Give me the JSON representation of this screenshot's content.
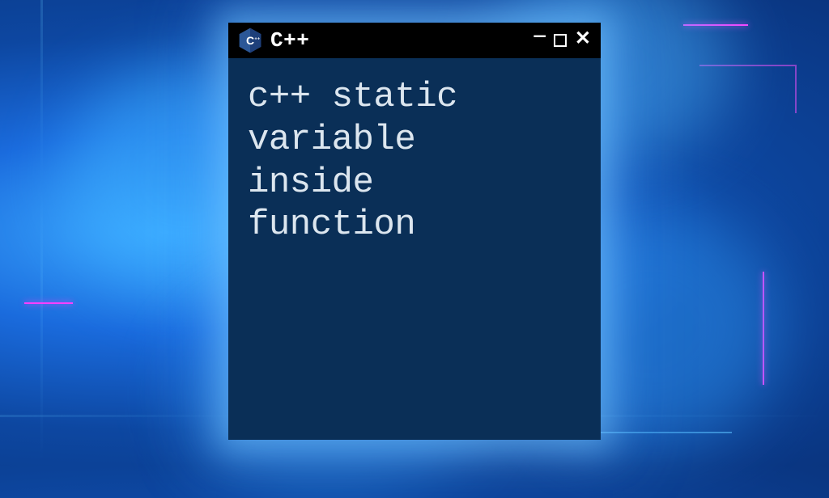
{
  "window": {
    "title": "C++",
    "icon_name": "cpp-logo-icon"
  },
  "content": {
    "text": "c++ static\nvariable\ninside\nfunction"
  },
  "colors": {
    "window_bg": "#0a2f57",
    "titlebar_bg": "#000000",
    "text": "#dce6ef",
    "accent_blue": "#1a6bdd",
    "accent_magenta": "#ff3fff"
  }
}
